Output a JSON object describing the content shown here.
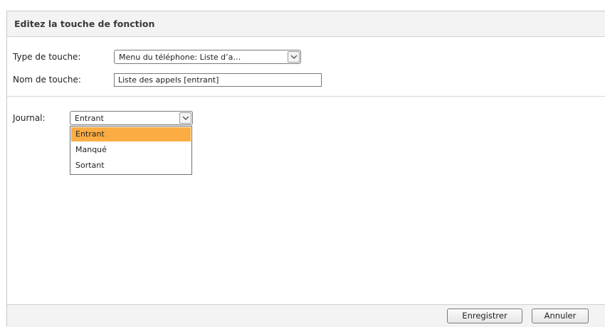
{
  "dialog": {
    "title": "Editez la touche de fonction"
  },
  "form": {
    "key_type": {
      "label": "Type de touche:",
      "value": "Menu du téléphone: Liste d’a…"
    },
    "key_name": {
      "label": "Nom de touche:",
      "value": "Liste des appels [entrant]"
    },
    "journal": {
      "label": "Journal:",
      "value": "Entrant",
      "options": [
        "Entrant",
        "Manqué",
        "Sortant"
      ],
      "highlighted_option": "Entrant"
    }
  },
  "footer": {
    "save_label": "Enregistrer",
    "cancel_label": "Annuler"
  },
  "colors": {
    "highlight": "#fbad43",
    "header_bg": "#f3f3f3"
  },
  "icons": {
    "dropdown_arrow": "chevron-down-icon"
  }
}
